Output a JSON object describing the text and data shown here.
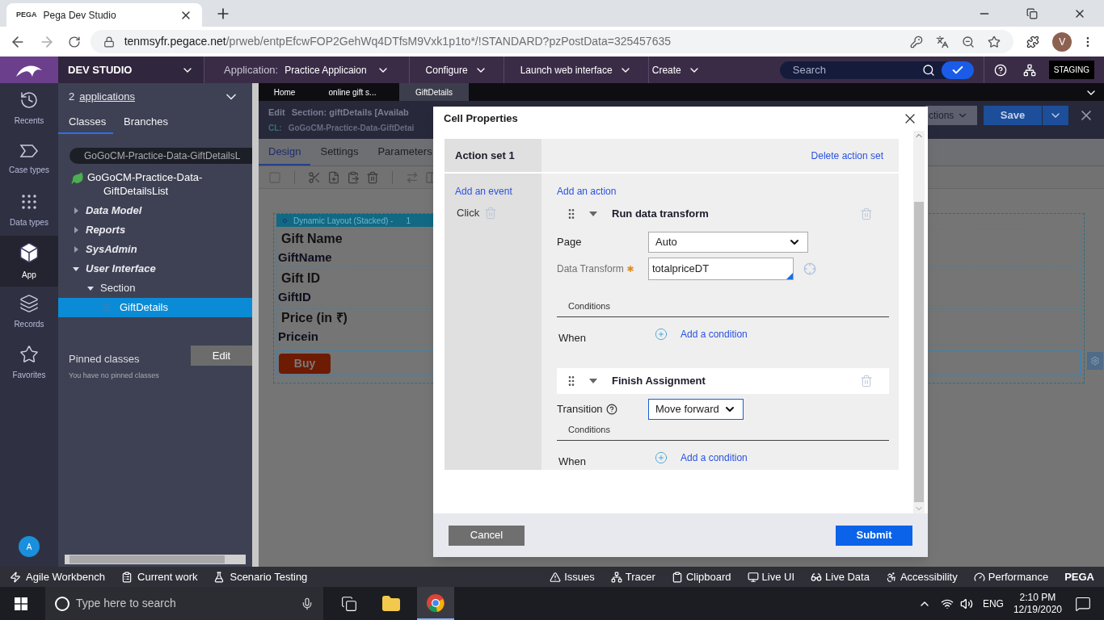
{
  "browser": {
    "favicon_text": "PEGA",
    "tab_title": "Pega Dev Studio",
    "url_host": "tenmsyfr.pegace.net",
    "url_path": "/prweb/entpEfcwFOP2GehWq4DTfsM9Vxk1p1to*/!STANDARD?pzPostData=325457635",
    "profile": "V"
  },
  "header": {
    "brand": "DEV STUDIO",
    "application_label": "Application:",
    "application_value": "Practice Applicaion",
    "menus": [
      "Configure",
      "Launch web interface",
      "Create"
    ],
    "search_placeholder": "Search",
    "environment": "STAGING"
  },
  "left_rail": {
    "items": [
      {
        "label": "Recents",
        "selected": false
      },
      {
        "label": "Case types",
        "selected": false
      },
      {
        "label": "Data types",
        "selected": false
      },
      {
        "label": "App",
        "selected": true
      },
      {
        "label": "Records",
        "selected": false
      },
      {
        "label": "Favorites",
        "selected": false
      }
    ],
    "avatar": "A"
  },
  "nav_panel": {
    "count": "2",
    "applications_link": "applications",
    "tabs": [
      {
        "label": "Classes",
        "selected": true
      },
      {
        "label": "Branches",
        "selected": false
      }
    ],
    "class_field": "GoGoCM-Practice-Data-GiftDetailsL",
    "root": "GoGoCM-Practice-Data-GiftDetailsList",
    "tree": [
      {
        "label": "Data Model",
        "expanded": false,
        "selected": false
      },
      {
        "label": "Reports",
        "expanded": false,
        "selected": false
      },
      {
        "label": "SysAdmin",
        "expanded": false,
        "selected": false
      },
      {
        "label": "User Interface",
        "expanded": true,
        "selected": false,
        "children": [
          {
            "label": "Section",
            "expanded": true,
            "selected": false,
            "children": [
              {
                "label": "GiftDetails",
                "selected": true
              }
            ]
          }
        ]
      }
    ],
    "pinned_title": "Pinned classes",
    "edit_button": "Edit",
    "pinned_empty": "You have no pinned classes"
  },
  "workspace": {
    "tabs": [
      {
        "label": "Home",
        "selected": false
      },
      {
        "label": "online gift s...",
        "selected": false
      },
      {
        "label": "GiftDetails",
        "selected": true
      }
    ],
    "title_prefix": "Edit",
    "title": "Section: giftDetails [Availab",
    "class_label": "CL:",
    "class_name": "GoGoCM-Practice-Data-GiftDetai",
    "actions_button": "ctions",
    "save_button": "Save",
    "design_tabs": [
      {
        "label": "Design",
        "selected": true
      },
      {
        "label": "Settings",
        "selected": false
      },
      {
        "label": "Parameters",
        "selected": false
      }
    ],
    "layout_title": "Dynamic Layout (Stacked) -",
    "layout_number": "1",
    "fields": [
      {
        "label": "Gift Name",
        "value": "GiftName"
      },
      {
        "label": "Gift ID",
        "value": "GiftID"
      },
      {
        "label": "Price (in ₹)",
        "value": "Pricein"
      }
    ],
    "buy_button": "Buy"
  },
  "dialog": {
    "title": "Cell Properties",
    "action_set": "Action set 1",
    "delete_link": "Delete action set",
    "add_event": "Add an event",
    "event": "Click",
    "add_action": "Add an action",
    "actions": [
      {
        "title": "Run data transform",
        "selected": false,
        "fields": [
          {
            "kind": "select",
            "label": "Page",
            "value": "Auto",
            "required": false,
            "help": false
          },
          {
            "kind": "input",
            "label": "Data Transform",
            "value": "totalpriceDT",
            "required": true,
            "help": false
          }
        ],
        "conditions": "Conditions",
        "when": "When",
        "add_condition": "Add a condition"
      },
      {
        "title": "Finish Assignment",
        "selected": true,
        "fields": [
          {
            "kind": "select",
            "label": "Transition",
            "value": "Move forward",
            "required": false,
            "help": true
          }
        ],
        "conditions": "Conditions",
        "when": "When",
        "add_condition": "Add a condition"
      }
    ],
    "cancel": "Cancel",
    "submit": "Submit"
  },
  "dev_toolbar": {
    "left": [
      "Agile Workbench",
      "Current work",
      "Scenario Testing"
    ],
    "right": [
      "Issues",
      "Tracer",
      "Clipboard",
      "Live UI",
      "Live Data",
      "Accessibility",
      "Performance"
    ],
    "brand": "PEGA"
  },
  "taskbar": {
    "search_placeholder": "Type here to search",
    "language": "ENG",
    "time": "2:10 PM",
    "date": "12/19/2020"
  }
}
